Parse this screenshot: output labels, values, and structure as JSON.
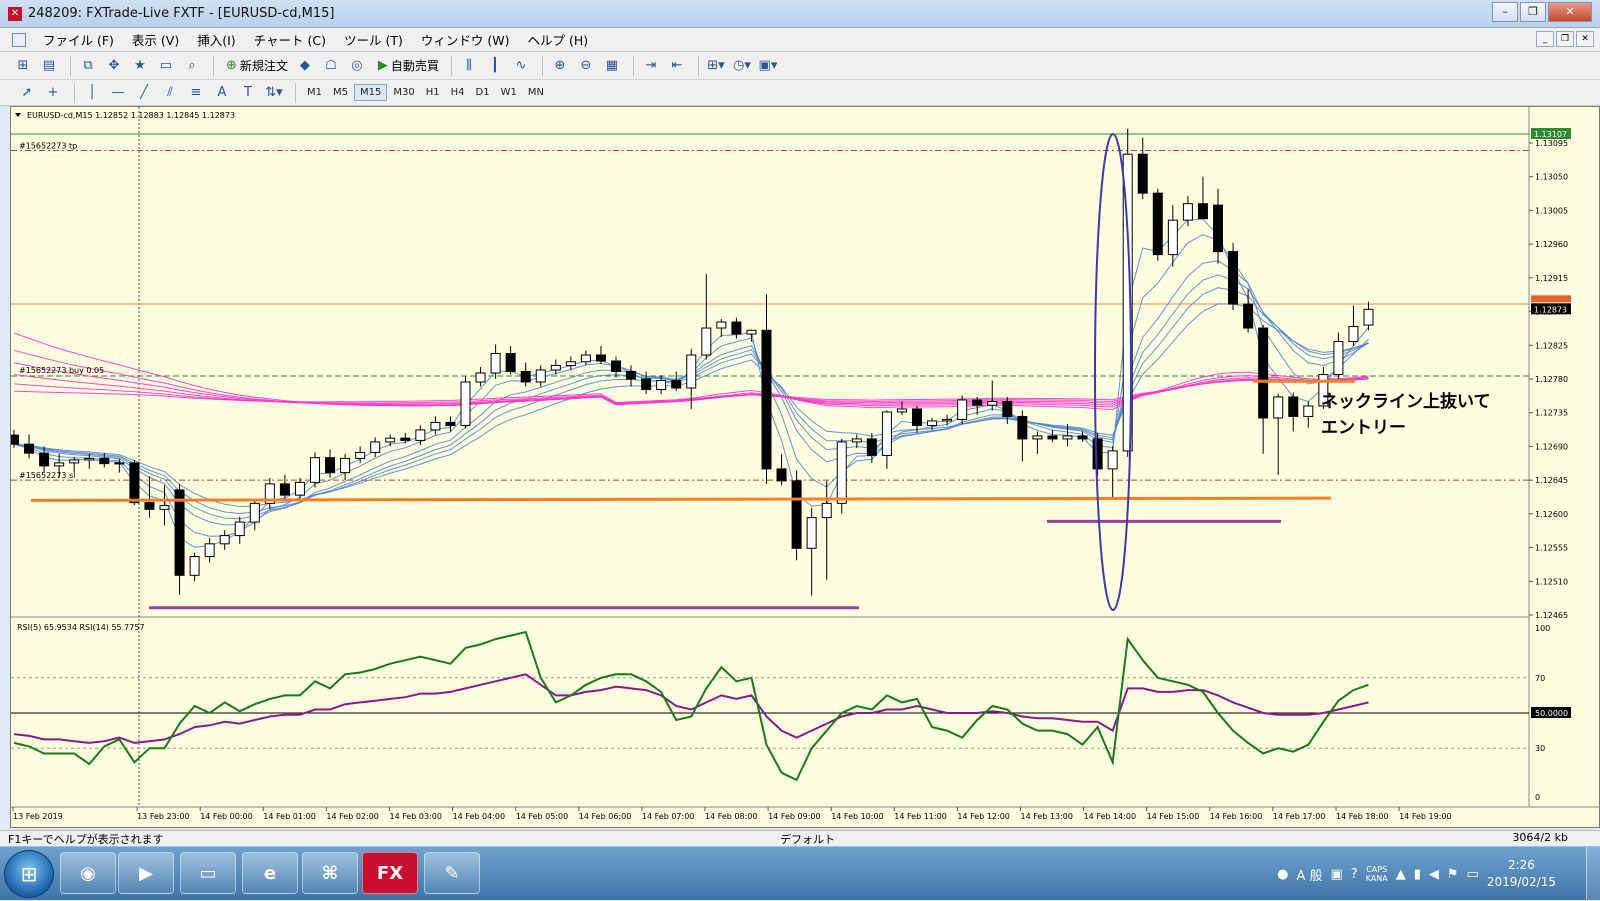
{
  "window": {
    "title": "248209: FXTrade-Live FXTF - [EURUSD-cd,M15]",
    "app_icon": "fx-logo-icon",
    "buttons": [
      "minimize-icon",
      "restore-icon",
      "close-icon"
    ]
  },
  "menu": {
    "items": [
      "ファイル (F)",
      "表示 (V)",
      "挿入(I)",
      "チャート (C)",
      "ツール (T)",
      "ウィンドウ (W)",
      "ヘルプ (H)"
    ]
  },
  "toolbar": {
    "new_order_label": "新規注文",
    "auto_trade_label": "自動売買"
  },
  "timeframes": [
    "M1",
    "M5",
    "M15",
    "M30",
    "H1",
    "H4",
    "D1",
    "W1",
    "MN"
  ],
  "active_timeframe": "M15",
  "chart": {
    "header": "EURUSD-cd,M15  1.12852 1.12883 1.12845 1.12873",
    "order_tp_label": "#15652273 tp",
    "order_buy_label": "#15652273 buy 0.05",
    "order_sl_label": "#15652273 sl",
    "annotation_line1": "ネックライン上抜いて",
    "annotation_line2": "エントリー",
    "price_tags": {
      "high": "1.13107",
      "current": "1.12873"
    },
    "y_ticks": [
      "1.13095",
      "1.13050",
      "1.13005",
      "1.12960",
      "1.12915",
      "1.12870",
      "1.12825",
      "1.12780",
      "1.12735",
      "1.12690",
      "1.12645",
      "1.12600",
      "1.12555",
      "1.12510",
      "1.12465"
    ],
    "x_ticks": [
      "13 Feb 2019",
      "13 Feb 23:00",
      "14 Feb 00:00",
      "14 Feb 01:00",
      "14 Feb 02:00",
      "14 Feb 03:00",
      "14 Feb 04:00",
      "14 Feb 05:00",
      "14 Feb 06:00",
      "14 Feb 07:00",
      "14 Feb 08:00",
      "14 Feb 09:00",
      "14 Feb 10:00",
      "14 Feb 11:00",
      "14 Feb 12:00",
      "14 Feb 13:00",
      "14 Feb 14:00",
      "14 Feb 15:00",
      "14 Feb 16:00",
      "14 Feb 17:00",
      "14 Feb 18:00",
      "14 Feb 19:00"
    ],
    "rsi_label": "RSI(5) 65.9534  RSI(14) 55.7757",
    "rsi_ticks": [
      "100",
      "70",
      "50.0000",
      "30",
      "0"
    ],
    "colors": {
      "background": "#fdfde0",
      "bull": "#ffffff",
      "bear": "#000000",
      "neckline": "#ff7f27",
      "support": "#9b3d9b",
      "ma_short": "#4a7fd0",
      "ma_long": "#ff33cc",
      "ellipse": "#3a3aaa",
      "rsi5": "#1a7a1a",
      "rsi14": "#8a1a8a"
    }
  },
  "chart_data": {
    "type": "candlestick",
    "symbol": "EURUSD-cd",
    "timeframe": "M15",
    "ylim": [
      1.12465,
      1.13135
    ],
    "ohlc": [
      [
        1.12705,
        1.12712,
        1.12688,
        1.12693
      ],
      [
        1.12693,
        1.12706,
        1.12674,
        1.12681
      ],
      [
        1.12681,
        1.1269,
        1.12655,
        1.12664
      ],
      [
        1.12664,
        1.1268,
        1.12648,
        1.12668
      ],
      [
        1.12668,
        1.12676,
        1.12656,
        1.12672
      ],
      [
        1.12672,
        1.1268,
        1.1266,
        1.12674
      ],
      [
        1.12674,
        1.12681,
        1.12662,
        1.12667
      ],
      [
        1.12667,
        1.12673,
        1.12655,
        1.12668
      ],
      [
        1.12668,
        1.12672,
        1.12612,
        1.12615
      ],
      [
        1.12615,
        1.1265,
        1.12595,
        1.12606
      ],
      [
        1.12606,
        1.12638,
        1.12585,
        1.12611
      ],
      [
        1.12632,
        1.1264,
        1.12492,
        1.12518
      ],
      [
        1.12518,
        1.12548,
        1.1251,
        1.12543
      ],
      [
        1.12543,
        1.12568,
        1.12535,
        1.1256
      ],
      [
        1.1256,
        1.12578,
        1.12552,
        1.12571
      ],
      [
        1.12571,
        1.12596,
        1.1256,
        1.12589
      ],
      [
        1.12589,
        1.1262,
        1.12578,
        1.12614
      ],
      [
        1.12614,
        1.12648,
        1.12606,
        1.1264
      ],
      [
        1.1264,
        1.12652,
        1.12618,
        1.12625
      ],
      [
        1.12625,
        1.12648,
        1.12618,
        1.12642
      ],
      [
        1.12642,
        1.12682,
        1.12635,
        1.12675
      ],
      [
        1.12675,
        1.12686,
        1.12648,
        1.12655
      ],
      [
        1.12655,
        1.1268,
        1.12645,
        1.12674
      ],
      [
        1.12674,
        1.1269,
        1.12668,
        1.12682
      ],
      [
        1.12682,
        1.12702,
        1.12676,
        1.12696
      ],
      [
        1.12696,
        1.12706,
        1.1269,
        1.12701
      ],
      [
        1.12701,
        1.12708,
        1.12694,
        1.12698
      ],
      [
        1.12698,
        1.12718,
        1.12692,
        1.12712
      ],
      [
        1.12712,
        1.1273,
        1.12706,
        1.12722
      ],
      [
        1.12722,
        1.1273,
        1.1271,
        1.12718
      ],
      [
        1.12718,
        1.12784,
        1.12714,
        1.12776
      ],
      [
        1.12776,
        1.12796,
        1.1277,
        1.12788
      ],
      [
        1.12788,
        1.12826,
        1.1278,
        1.12814
      ],
      [
        1.12814,
        1.12824,
        1.12786,
        1.1279
      ],
      [
        1.1279,
        1.12802,
        1.1277,
        1.12776
      ],
      [
        1.12776,
        1.12798,
        1.1277,
        1.12792
      ],
      [
        1.12792,
        1.12806,
        1.12786,
        1.12798
      ],
      [
        1.12798,
        1.1281,
        1.12792,
        1.12803
      ],
      [
        1.12803,
        1.12818,
        1.12798,
        1.12812
      ],
      [
        1.12812,
        1.12824,
        1.128,
        1.12804
      ],
      [
        1.12804,
        1.1281,
        1.12782,
        1.1279
      ],
      [
        1.1279,
        1.12798,
        1.1277,
        1.1278
      ],
      [
        1.1278,
        1.1279,
        1.1276,
        1.12766
      ],
      [
        1.12766,
        1.12785,
        1.1276,
        1.12778
      ],
      [
        1.12778,
        1.1279,
        1.12764,
        1.12768
      ],
      [
        1.12768,
        1.1282,
        1.1274,
        1.12812
      ],
      [
        1.12812,
        1.1292,
        1.12806,
        1.12848
      ],
      [
        1.12848,
        1.1286,
        1.12836,
        1.12856
      ],
      [
        1.12856,
        1.12862,
        1.12834,
        1.1284
      ],
      [
        1.1284,
        1.12846,
        1.1283,
        1.12845
      ],
      [
        1.12845,
        1.12893,
        1.1264,
        1.1266
      ],
      [
        1.1266,
        1.1268,
        1.12638,
        1.12644
      ],
      [
        1.12644,
        1.12658,
        1.12538,
        1.12554
      ],
      [
        1.12554,
        1.12608,
        1.12491,
        1.12595
      ],
      [
        1.12595,
        1.12644,
        1.12512,
        1.12614
      ],
      [
        1.12614,
        1.127,
        1.126,
        1.12696
      ],
      [
        1.12696,
        1.12706,
        1.12688,
        1.127
      ],
      [
        1.127,
        1.12708,
        1.12668,
        1.12678
      ],
      [
        1.12678,
        1.12738,
        1.1266,
        1.12736
      ],
      [
        1.12736,
        1.1275,
        1.12732,
        1.1274
      ],
      [
        1.1274,
        1.12744,
        1.12708,
        1.12718
      ],
      [
        1.12718,
        1.12728,
        1.12712,
        1.12724
      ],
      [
        1.12724,
        1.12732,
        1.12718,
        1.12726
      ],
      [
        1.12726,
        1.12758,
        1.1272,
        1.12752
      ],
      [
        1.12752,
        1.12756,
        1.12732,
        1.12745
      ],
      [
        1.12745,
        1.12778,
        1.12738,
        1.1275
      ],
      [
        1.1275,
        1.12756,
        1.1272,
        1.1273
      ],
      [
        1.1273,
        1.12738,
        1.1267,
        1.127
      ],
      [
        1.127,
        1.1271,
        1.1268,
        1.12704
      ],
      [
        1.12704,
        1.12712,
        1.12696,
        1.127
      ],
      [
        1.127,
        1.1272,
        1.1269,
        1.12704
      ],
      [
        1.12704,
        1.1271,
        1.12696,
        1.127
      ],
      [
        1.127,
        1.12708,
        1.1265,
        1.1266
      ],
      [
        1.1266,
        1.1269,
        1.1262,
        1.12684
      ],
      [
        1.12684,
        1.13114,
        1.12676,
        1.1308
      ],
      [
        1.1308,
        1.13102,
        1.1302,
        1.13028
      ],
      [
        1.13028,
        1.13034,
        1.12938,
        1.12946
      ],
      [
        1.12946,
        1.13012,
        1.1293,
        1.12992
      ],
      [
        1.12992,
        1.13024,
        1.12984,
        1.13014
      ],
      [
        1.13014,
        1.1305,
        1.13002,
        1.12994
      ],
      [
        1.13012,
        1.13034,
        1.12934,
        1.1295
      ],
      [
        1.1295,
        1.12962,
        1.12872,
        1.1288
      ],
      [
        1.1288,
        1.129,
        1.12842,
        1.12848
      ],
      [
        1.12848,
        1.12852,
        1.1268,
        1.12728
      ],
      [
        1.12728,
        1.1276,
        1.12652,
        1.12756
      ],
      [
        1.12756,
        1.12762,
        1.1271,
        1.1273
      ],
      [
        1.1273,
        1.1275,
        1.12715,
        1.12744
      ],
      [
        1.12744,
        1.12796,
        1.1274,
        1.12786
      ],
      [
        1.12786,
        1.12842,
        1.1278,
        1.1283
      ],
      [
        1.1283,
        1.12878,
        1.12824,
        1.1285
      ],
      [
        1.12852,
        1.12883,
        1.12845,
        1.12873
      ]
    ],
    "levels": {
      "tp": 1.13085,
      "buy": 1.12784,
      "sl": 1.12645,
      "high_line": 1.13107,
      "neckline": 1.12783,
      "support_left": 1.12488,
      "support_right": 1.1259
    },
    "ma_long": [
      1.12905,
      1.12872,
      1.12848,
      1.12826,
      1.12808,
      1.12794
    ],
    "rsi5": [
      33,
      31,
      27,
      27,
      27,
      21,
      31,
      35,
      22,
      30,
      30,
      44,
      54,
      50,
      56,
      51,
      55,
      58,
      60,
      60,
      68,
      64,
      72,
      73,
      75,
      78,
      80,
      82,
      80,
      78,
      87,
      89,
      92,
      94,
      96,
      70,
      56,
      60,
      66,
      70,
      72,
      72,
      68,
      62,
      46,
      48,
      64,
      76,
      68,
      70,
      32,
      16,
      12,
      30,
      40,
      50,
      54,
      52,
      60,
      56,
      58,
      42,
      40,
      36,
      46,
      54,
      52,
      44,
      40,
      40,
      38,
      32,
      42,
      22,
      92,
      80,
      70,
      68,
      66,
      62,
      50,
      40,
      33,
      27,
      30,
      28,
      32,
      45,
      57,
      63,
      66
    ],
    "rsi14": [
      38,
      37,
      35,
      35,
      34,
      33,
      34,
      36,
      33,
      34,
      35,
      38,
      42,
      43,
      45,
      44,
      46,
      48,
      49,
      49,
      52,
      52,
      55,
      56,
      57,
      58,
      59,
      61,
      61,
      62,
      64,
      66,
      68,
      70,
      72,
      66,
      60,
      60,
      62,
      63,
      65,
      64,
      63,
      60,
      54,
      52,
      56,
      60,
      58,
      60,
      48,
      40,
      36,
      40,
      44,
      48,
      50,
      50,
      52,
      52,
      54,
      52,
      50,
      50,
      50,
      51,
      50,
      48,
      47,
      47,
      46,
      45,
      45,
      40,
      64,
      64,
      62,
      62,
      63,
      63,
      60,
      56,
      53,
      50,
      49,
      49,
      49,
      50,
      52,
      54,
      56
    ]
  },
  "status": {
    "help_text": "F1キーでヘルプが表示されます",
    "profile_text": "デフォルト",
    "traffic_text": "3064/2 kb"
  },
  "taskbar": {
    "apps": [
      "chrome-icon",
      "media-player-icon",
      "explorer-icon",
      "ie-icon",
      "acrobat-icon",
      "fx-app-icon",
      "paint-icon"
    ],
    "fx_label": "FX",
    "ime_label": "A 般",
    "caps_label": "CAPS",
    "kana_label": "KANA",
    "time": "2:26",
    "date": "2019/02/15"
  }
}
